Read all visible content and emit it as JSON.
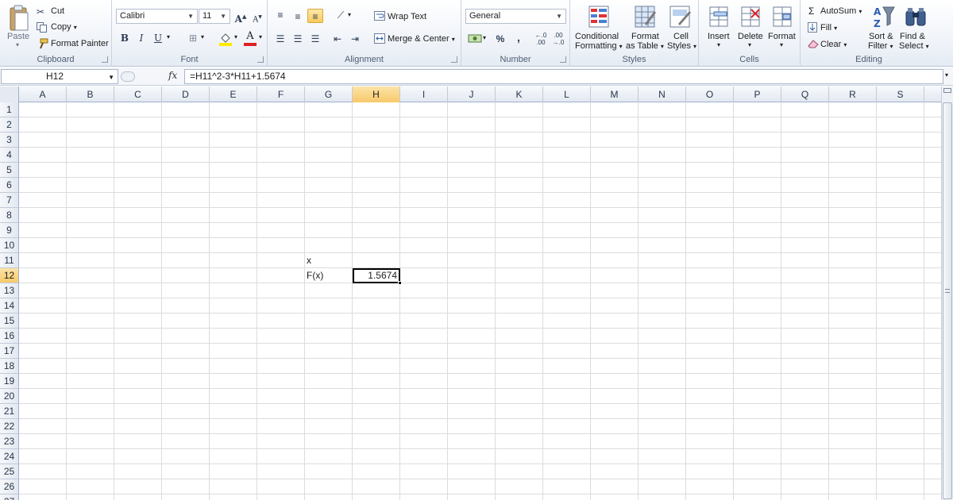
{
  "ribbon": {
    "clipboard": {
      "label": "Clipboard",
      "paste": "Paste",
      "cut": "Cut",
      "copy": "Copy",
      "format_painter": "Format Painter"
    },
    "font": {
      "label": "Font",
      "family": "Calibri",
      "size": "11",
      "bold": "B",
      "italic": "I",
      "underline": "U"
    },
    "alignment": {
      "label": "Alignment",
      "wrap_text": "Wrap Text",
      "merge_center": "Merge & Center"
    },
    "number": {
      "label": "Number",
      "format": "General",
      "percent": "%",
      "comma": ","
    },
    "styles": {
      "label": "Styles",
      "conditional_line1": "Conditional",
      "conditional_line2": "Formatting",
      "table_line1": "Format",
      "table_line2": "as Table",
      "cell_line1": "Cell",
      "cell_line2": "Styles"
    },
    "cells": {
      "label": "Cells",
      "insert": "Insert",
      "delete": "Delete",
      "format": "Format"
    },
    "editing": {
      "label": "Editing",
      "autosum": "AutoSum",
      "fill": "Fill",
      "clear": "Clear",
      "sort_line1": "Sort &",
      "sort_line2": "Filter",
      "find_line1": "Find &",
      "find_line2": "Select"
    }
  },
  "formula_bar": {
    "name_box": "H12",
    "fx": "fx",
    "formula": "=H11^2-3*H11+1.5674"
  },
  "sheet": {
    "columns": [
      "A",
      "B",
      "C",
      "D",
      "E",
      "F",
      "G",
      "H",
      "I",
      "J",
      "K",
      "L",
      "M",
      "N",
      "O",
      "P",
      "Q",
      "R",
      "S"
    ],
    "rows": [
      "1",
      "2",
      "3",
      "4",
      "5",
      "6",
      "7",
      "8",
      "9",
      "10",
      "11",
      "12",
      "13",
      "14",
      "15",
      "16",
      "17",
      "18",
      "19",
      "20",
      "21",
      "22",
      "23",
      "24",
      "25",
      "26",
      "27"
    ],
    "selected_column": "H",
    "selected_row": "12",
    "cells": {
      "G11": "x",
      "G12": "F(x)",
      "H12": "1.5674"
    }
  },
  "colors": {
    "selection_header": "#f8c96a",
    "gridline": "#dadcdd",
    "ribbon_bg": "#eef2f8"
  }
}
